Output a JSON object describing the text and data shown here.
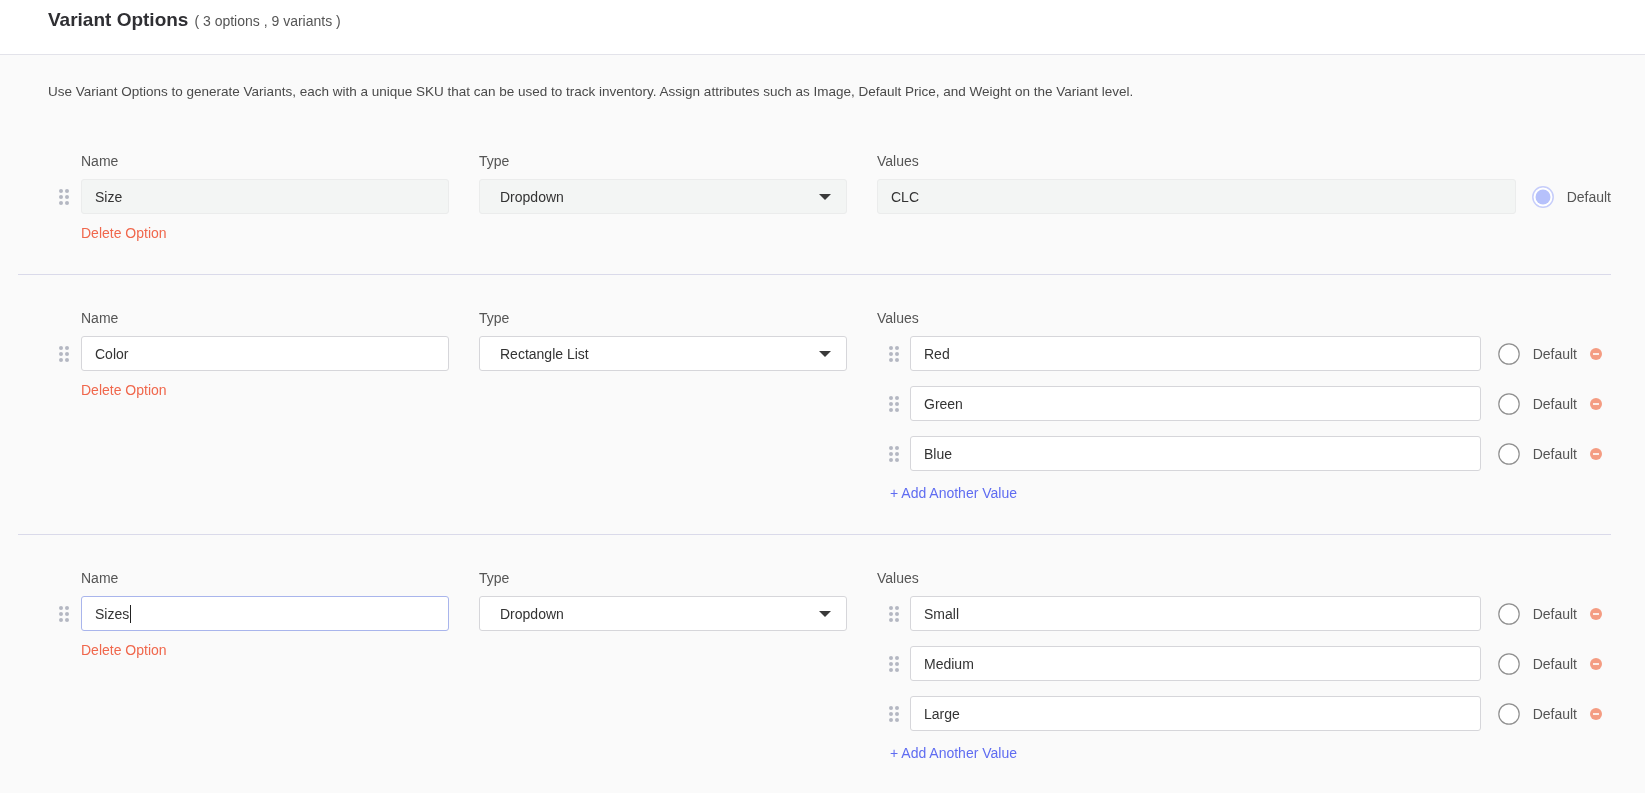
{
  "header": {
    "title": "Variant Options",
    "summary": "( 3 options , 9 variants )"
  },
  "description": "Use Variant Options to generate Variants, each with a unique SKU that can be used to track inventory. Assign attributes such as Image, Default Price, and Weight on the Variant level.",
  "options": [
    {
      "disabled": true,
      "name_label": "Name",
      "name": "Size",
      "name_focused": false,
      "delete_link": "Delete Option",
      "type_label": "Type",
      "type": "Dropdown",
      "values_label": "Values",
      "values": [
        {
          "value": "CLC",
          "selected": true,
          "default_label": "Default"
        }
      ]
    },
    {
      "disabled": false,
      "name_label": "Name",
      "name": "Color",
      "name_focused": false,
      "delete_link": "Delete Option",
      "type_label": "Type",
      "type": "Rectangle List",
      "values_label": "Values",
      "values": [
        {
          "value": "Red",
          "selected": false,
          "default_label": "Default"
        },
        {
          "value": "Green",
          "selected": false,
          "default_label": "Default"
        },
        {
          "value": "Blue",
          "selected": false,
          "default_label": "Default"
        }
      ],
      "add_link": "+ Add Another Value"
    },
    {
      "disabled": false,
      "name_label": "Name",
      "name": "Sizes",
      "name_focused": true,
      "delete_link": "Delete Option",
      "type_label": "Type",
      "type": "Dropdown",
      "values_label": "Values",
      "values": [
        {
          "value": "Small",
          "selected": false,
          "default_label": "Default"
        },
        {
          "value": "Medium",
          "selected": false,
          "default_label": "Default"
        },
        {
          "value": "Large",
          "selected": false,
          "default_label": "Default"
        }
      ],
      "add_link": "+ Add Another Value"
    }
  ]
}
